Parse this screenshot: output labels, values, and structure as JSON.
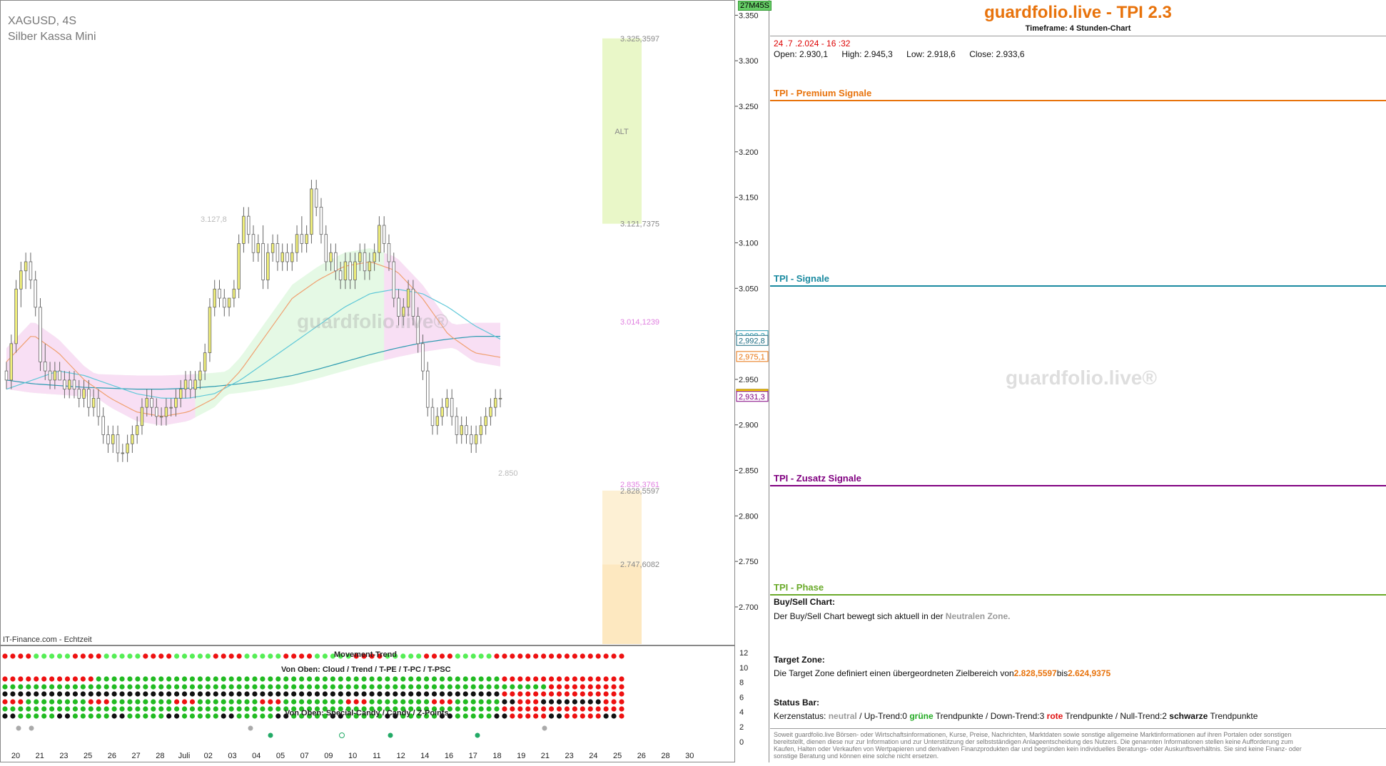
{
  "instrument": {
    "symbol": "XAGUSD, 4S",
    "name": "Silber Kassa Mini"
  },
  "timer": "27M45S",
  "feed": "IT-Finance.com - Echtzeit",
  "watermark": "guardfolio.live®",
  "colors": {
    "up": "#f0ef7a",
    "down": "#ffffff",
    "cloud_green": "#dff7df",
    "cloud_pink": "#fadcf5",
    "orange": "#e8730c",
    "teal": "#1a8aa0",
    "purple": "#800080",
    "phase_green": "#6aaa2a",
    "dot_green": "#22bb22",
    "dot_red": "#ee1111",
    "dot_black": "#111111"
  },
  "chart_data": [
    {
      "type": "candlestick",
      "ylim": [
        2.66,
        3.355
      ],
      "y_ticks": [
        "3.350",
        "3.300",
        "3.250",
        "3.200",
        "3.150",
        "3.100",
        "3.050",
        "3.000",
        "2.950",
        "2.900",
        "2.850",
        "2.800",
        "2.750",
        "2.700"
      ],
      "x_labels": [
        "20",
        "21",
        "23",
        "25",
        "26",
        "27",
        "28",
        "Juli",
        "02",
        "03",
        "04",
        "05",
        "07",
        "09",
        "10",
        "11",
        "12",
        "14",
        "16",
        "17",
        "18",
        "19",
        "21",
        "23",
        "24",
        "25",
        "26",
        "28",
        "30"
      ],
      "candles": [
        [
          2.96,
          2.97,
          2.94,
          2.95
        ],
        [
          2.95,
          3.0,
          2.94,
          2.99
        ],
        [
          2.99,
          3.06,
          2.98,
          3.05
        ],
        [
          3.05,
          3.08,
          3.03,
          3.07
        ],
        [
          3.07,
          3.09,
          3.05,
          3.08
        ],
        [
          3.08,
          3.09,
          3.05,
          3.06
        ],
        [
          3.06,
          3.07,
          3.02,
          3.03
        ],
        [
          3.03,
          3.04,
          2.96,
          2.97
        ],
        [
          2.97,
          2.99,
          2.95,
          2.96
        ],
        [
          2.96,
          2.97,
          2.94,
          2.95
        ],
        [
          2.95,
          2.97,
          2.94,
          2.96
        ],
        [
          2.96,
          2.97,
          2.95,
          2.95
        ],
        [
          2.95,
          2.96,
          2.93,
          2.94
        ],
        [
          2.94,
          2.96,
          2.93,
          2.95
        ],
        [
          2.95,
          2.96,
          2.93,
          2.94
        ],
        [
          2.94,
          2.95,
          2.92,
          2.93
        ],
        [
          2.93,
          2.95,
          2.92,
          2.94
        ],
        [
          2.94,
          2.95,
          2.91,
          2.92
        ],
        [
          2.92,
          2.94,
          2.91,
          2.93
        ],
        [
          2.93,
          2.94,
          2.9,
          2.91
        ],
        [
          2.91,
          2.92,
          2.88,
          2.89
        ],
        [
          2.89,
          2.9,
          2.87,
          2.88
        ],
        [
          2.88,
          2.9,
          2.87,
          2.89
        ],
        [
          2.89,
          2.9,
          2.86,
          2.87
        ],
        [
          2.87,
          2.88,
          2.86,
          2.87
        ],
        [
          2.87,
          2.89,
          2.86,
          2.88
        ],
        [
          2.88,
          2.9,
          2.87,
          2.89
        ],
        [
          2.89,
          2.91,
          2.88,
          2.9
        ],
        [
          2.9,
          2.93,
          2.89,
          2.92
        ],
        [
          2.92,
          2.94,
          2.91,
          2.93
        ],
        [
          2.93,
          2.94,
          2.91,
          2.92
        ],
        [
          2.92,
          2.93,
          2.9,
          2.91
        ],
        [
          2.91,
          2.92,
          2.9,
          2.91
        ],
        [
          2.91,
          2.93,
          2.9,
          2.92
        ],
        [
          2.92,
          2.93,
          2.91,
          2.92
        ],
        [
          2.92,
          2.94,
          2.91,
          2.93
        ],
        [
          2.93,
          2.95,
          2.92,
          2.94
        ],
        [
          2.94,
          2.96,
          2.93,
          2.95
        ],
        [
          2.95,
          2.96,
          2.93,
          2.94
        ],
        [
          2.94,
          2.96,
          2.93,
          2.95
        ],
        [
          2.95,
          2.97,
          2.94,
          2.96
        ],
        [
          2.96,
          2.99,
          2.95,
          2.98
        ],
        [
          2.98,
          3.04,
          2.97,
          3.03
        ],
        [
          3.03,
          3.06,
          3.02,
          3.05
        ],
        [
          3.05,
          3.06,
          3.03,
          3.04
        ],
        [
          3.04,
          3.05,
          3.02,
          3.03
        ],
        [
          3.03,
          3.04,
          3.02,
          3.04
        ],
        [
          3.04,
          3.06,
          3.03,
          3.05
        ],
        [
          3.05,
          3.11,
          3.04,
          3.1
        ],
        [
          3.1,
          3.14,
          3.09,
          3.13
        ],
        [
          3.13,
          3.14,
          3.1,
          3.11
        ],
        [
          3.11,
          3.12,
          3.08,
          3.09
        ],
        [
          3.09,
          3.11,
          3.08,
          3.1
        ],
        [
          3.1,
          3.12,
          3.05,
          3.06
        ],
        [
          3.06,
          3.1,
          3.05,
          3.09
        ],
        [
          3.09,
          3.11,
          3.08,
          3.1
        ],
        [
          3.1,
          3.11,
          3.07,
          3.08
        ],
        [
          3.08,
          3.1,
          3.07,
          3.09
        ],
        [
          3.09,
          3.1,
          3.07,
          3.08
        ],
        [
          3.08,
          3.1,
          3.07,
          3.09
        ],
        [
          3.09,
          3.12,
          3.08,
          3.11
        ],
        [
          3.11,
          3.13,
          3.09,
          3.1
        ],
        [
          3.1,
          3.12,
          3.09,
          3.11
        ],
        [
          3.11,
          3.17,
          3.1,
          3.16
        ],
        [
          3.16,
          3.17,
          3.13,
          3.14
        ],
        [
          3.14,
          3.15,
          3.1,
          3.11
        ],
        [
          3.11,
          3.12,
          3.07,
          3.08
        ],
        [
          3.08,
          3.1,
          3.07,
          3.09
        ],
        [
          3.09,
          3.1,
          3.06,
          3.07
        ],
        [
          3.07,
          3.08,
          3.05,
          3.06
        ],
        [
          3.06,
          3.09,
          3.05,
          3.08
        ],
        [
          3.08,
          3.09,
          3.05,
          3.06
        ],
        [
          3.06,
          3.09,
          3.05,
          3.08
        ],
        [
          3.08,
          3.1,
          3.07,
          3.09
        ],
        [
          3.09,
          3.1,
          3.06,
          3.07
        ],
        [
          3.07,
          3.09,
          3.06,
          3.08
        ],
        [
          3.08,
          3.1,
          3.07,
          3.09
        ],
        [
          3.09,
          3.13,
          3.08,
          3.12
        ],
        [
          3.12,
          3.13,
          3.09,
          3.1
        ],
        [
          3.1,
          3.11,
          3.07,
          3.08
        ],
        [
          3.08,
          3.09,
          3.03,
          3.04
        ],
        [
          3.04,
          3.05,
          3.01,
          3.02
        ],
        [
          3.02,
          3.04,
          3.01,
          3.03
        ],
        [
          3.03,
          3.06,
          3.02,
          3.05
        ],
        [
          3.05,
          3.06,
          3.01,
          3.02
        ],
        [
          3.02,
          3.03,
          2.98,
          2.99
        ],
        [
          2.99,
          3.0,
          2.95,
          2.96
        ],
        [
          2.96,
          2.97,
          2.91,
          2.92
        ],
        [
          2.92,
          2.93,
          2.89,
          2.9
        ],
        [
          2.9,
          2.92,
          2.89,
          2.91
        ],
        [
          2.91,
          2.93,
          2.9,
          2.92
        ],
        [
          2.92,
          2.94,
          2.91,
          2.93
        ],
        [
          2.93,
          2.94,
          2.9,
          2.91
        ],
        [
          2.91,
          2.92,
          2.88,
          2.89
        ],
        [
          2.89,
          2.91,
          2.88,
          2.9
        ],
        [
          2.9,
          2.91,
          2.88,
          2.89
        ],
        [
          2.89,
          2.9,
          2.87,
          2.88
        ],
        [
          2.88,
          2.9,
          2.87,
          2.89
        ],
        [
          2.89,
          2.91,
          2.88,
          2.9
        ],
        [
          2.9,
          2.92,
          2.89,
          2.91
        ],
        [
          2.91,
          2.93,
          2.9,
          2.92
        ],
        [
          2.92,
          2.94,
          2.91,
          2.93
        ],
        [
          2.93,
          2.94,
          2.92,
          2.93
        ]
      ],
      "lines": [
        {
          "color": "#2a9ab0",
          "values": [
            2.95,
            2.946,
            2.944,
            2.942,
            2.941,
            2.94,
            2.94,
            2.941,
            2.943,
            2.946,
            2.95,
            2.955,
            2.962,
            2.97,
            2.978,
            2.985,
            2.991,
            2.995,
            2.998,
            2.998
          ]
        },
        {
          "color": "#5ec8d8",
          "values": [
            2.94,
            2.95,
            2.96,
            2.955,
            2.945,
            2.935,
            2.93,
            2.93,
            2.935,
            2.95,
            2.97,
            2.99,
            3.01,
            3.03,
            3.045,
            3.05,
            3.045,
            3.03,
            3.01,
            2.995
          ]
        },
        {
          "color": "#f0a070",
          "values": [
            2.97,
            3.0,
            2.98,
            2.95,
            2.93,
            2.915,
            2.91,
            2.915,
            2.93,
            2.96,
            3.0,
            3.04,
            3.06,
            3.075,
            3.08,
            3.07,
            3.04,
            3.0,
            2.98,
            2.975
          ]
        }
      ],
      "price_labels": [
        {
          "text": "2,998,2",
          "value": 2.998,
          "color": "#2a9ab0"
        },
        {
          "text": "2,992,8",
          "value": 2.9928,
          "color": "#1a6a80"
        },
        {
          "text": "2,975,1",
          "value": 2.9751,
          "color": "#e8730c"
        },
        {
          "text": "2,933,6",
          "value": 2.9336,
          "color": "#000"
        },
        {
          "text": "2,931,3",
          "value": 2.9313,
          "color": "#800080"
        }
      ],
      "zones": [
        {
          "label": "ALT",
          "top": 3.3253597,
          "bottom": 3.1217375,
          "color": "#e9f7c8"
        },
        {
          "label": "",
          "top": 2.8285597,
          "bottom": 2.7476082,
          "color": "#fdf0d4"
        },
        {
          "label": "",
          "top": 2.7476082,
          "bottom": 2.66,
          "color": "#fde8c0"
        }
      ],
      "zone_labels": [
        {
          "text": "3.325,3597",
          "value": 3.3253597,
          "color": "#888"
        },
        {
          "text": "3.121,7375",
          "value": 3.1217375,
          "color": "#888"
        },
        {
          "text": "3.014,1239",
          "value": 3.0141239,
          "color": "#e080e0"
        },
        {
          "text": "2.835,3761",
          "value": 2.8353761,
          "color": "#e080e0"
        },
        {
          "text": "2.828,5597",
          "value": 2.8285597,
          "color": "#888"
        },
        {
          "text": "2.747,6082",
          "value": 2.7476082,
          "color": "#888"
        }
      ],
      "annotations": [
        {
          "text": "3.127,8",
          "value": 3.127,
          "color": "#bbb"
        },
        {
          "text": "2.850",
          "value": 2.848,
          "color": "#bbb"
        }
      ]
    },
    {
      "type": "dot-matrix",
      "title": "Movement-Trend",
      "label_mid": "Von Oben: Cloud / Trend / T-PE / T-PC / T-PSC",
      "label_bottom": "Von Oben: Special-Candy / Candy / Z-Points",
      "y_ticks": [
        "12",
        "10",
        "8",
        "6",
        "4",
        "2",
        "0"
      ]
    }
  ],
  "right": {
    "title": "guardfolio.live - TPI 2.3",
    "subtitle": "Timeframe: 4 Stunden-Chart",
    "datetime": "24 .7 .2.024  - 16 :32",
    "ohlc": {
      "open": "Open:  2.930,1",
      "high": "High:   2.945,3",
      "low": "Low:   2.918,6",
      "close": "Close:  2.933,6"
    },
    "sections": {
      "premium": "TPI - Premium Signale",
      "signale": "TPI - Signale",
      "zusatz": "TPI - Zusatz Signale",
      "phase": "TPI - Phase"
    },
    "buysell": {
      "title": "Buy/Sell Chart:",
      "text": "Der Buy/Sell Chart bewegt sich aktuell in der ",
      "zone": "Neutralen Zone."
    },
    "target": {
      "title": "Target Zone:",
      "text": "Die Target Zone definiert einen übergeordneten Zielbereich von",
      "from": "2.828,5597",
      "mid": "bis",
      "to": "2.624,9375"
    },
    "status": {
      "title": "Status Bar:",
      "p1": "Kerzenstatus: ",
      "neutral": "neutral",
      "p2": "  / Up-Trend:0 ",
      "gruene": "grüne",
      "p3": " Trendpunkte  / Down-Trend:3 ",
      "rote": "rote",
      "p4": " Trendpunkte / Null-Trend:2 ",
      "schwarze": "schwarze",
      "p5": " Trendpunkte"
    },
    "disclaimer": "Soweit guardfolio.live Börsen- oder Wirtschaftsinformationen, Kurse, Preise, Nachrichten, Marktdaten sowie sonstige allgemeine Marktinformationen auf ihren Portalen oder sonstigen bereitstellt, dienen diese nur zur Information und zur Unterstützung der selbstständigen Anlageentscheidung des Nutzers. Die genannten Informationen stellen keine Aufforderung zum Kaufen, Halten oder Verkaufen von Wertpapieren und derivativen Finanzprodukten dar und begründen kein individuelles Beratungs- oder Auskunftsverhältnis. Sie sind keine Finanz- oder sonstige Beratung und können eine solche nicht ersetzen."
  }
}
